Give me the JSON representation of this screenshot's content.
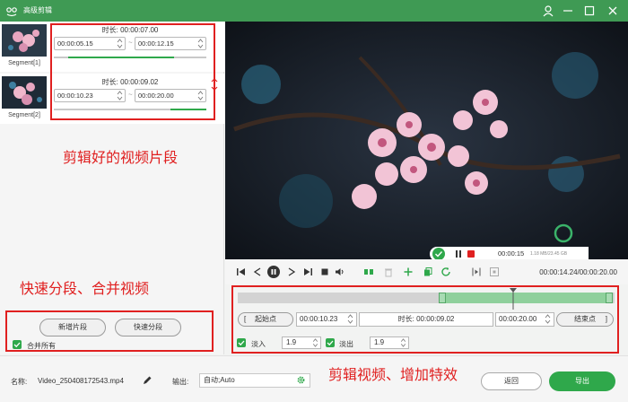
{
  "app": {
    "title": "高级剪辑",
    "brand_color": "#3f9a54",
    "accent_color": "#2fa84b",
    "annotation_color": "#e02020"
  },
  "segments": [
    {
      "label": "Segment[1]",
      "duration_label": "时长:",
      "duration": "00:00:07.00",
      "start": "00:00:05.15",
      "end": "00:00:12.15"
    },
    {
      "label": "Segment[2]",
      "duration_label": "时长:",
      "duration": "00:00:09.02",
      "start": "00:00:10.23",
      "end": "00:00:20.00"
    }
  ],
  "left_actions": {
    "add_segment": "新增片段",
    "quick_split": "快速分段",
    "merge_all": "合并所有"
  },
  "annotations": {
    "segments": "剪辑好的视频片段",
    "split_merge": "快速分段、合并视频",
    "edit_effects": "剪辑视频、增加特效"
  },
  "recorder": {
    "time": "00:00:15",
    "size": "1.18 MB/23.45 GB"
  },
  "player": {
    "time": "00:00:14.24/00:00:20.00"
  },
  "edit": {
    "start_point_label": "起始点",
    "start_value": "00:00:10.23",
    "duration_label": "时长:",
    "duration_value": "00:00:09.02",
    "end_value": "00:00:20.00",
    "end_point_label": "结束点",
    "fade_in_label": "淡入",
    "fade_in_value": "1.9",
    "fade_out_label": "淡出",
    "fade_out_value": "1.9"
  },
  "bottom": {
    "name_label": "名称:",
    "file_name": "Video_250408172543.mp4",
    "output_label": "输出:",
    "output_value": "自动;Auto",
    "back_label": "返回",
    "export_label": "导出"
  }
}
